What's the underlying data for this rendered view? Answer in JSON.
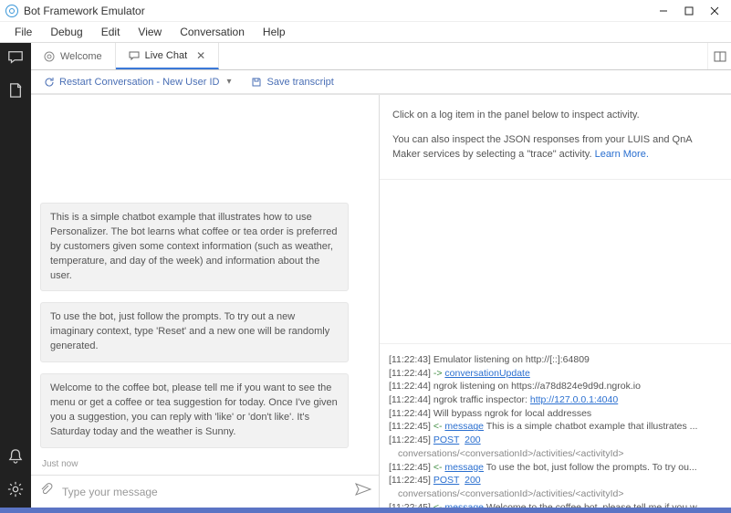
{
  "titlebar": {
    "title": "Bot Framework Emulator"
  },
  "menu": {
    "items": [
      "File",
      "Debug",
      "Edit",
      "View",
      "Conversation",
      "Help"
    ]
  },
  "tabs": {
    "welcome": "Welcome",
    "livechat": "Live Chat"
  },
  "toolbar": {
    "restart": "Restart Conversation - New User ID",
    "save": "Save transcript"
  },
  "chat": {
    "messages": [
      "This is a simple chatbot example that illustrates how to use Personalizer. The bot learns what coffee or tea order is preferred by customers given some context information (such as weather, temperature, and day of the week) and information about the user.",
      "To use the bot, just follow the prompts. To try out a new imaginary context, type 'Reset' and a new one will be randomly generated.",
      "Welcome to the coffee bot, please tell me if you want to see the menu or get a coffee or tea suggestion for today. Once I've given you a suggestion, you can reply with 'like' or 'don't like'. It's Saturday today and the weather is Sunny."
    ],
    "timestamp": "Just now",
    "placeholder": "Type your message"
  },
  "inspector": {
    "line1": "Click on a log item in the panel below to inspect activity.",
    "line2a": "You can also inspect the JSON responses from your LUIS and QnA Maker services by selecting a \"trace\" activity. ",
    "learn_more": "Learn More."
  },
  "log": {
    "l0_ts": "[11:22:43]",
    "l0_txt": " Emulator listening on http://[::]:64809",
    "l1_ts": "[11:22:44]",
    "l1_dir": " -> ",
    "l1_link": "conversationUpdate",
    "l2_ts": "[11:22:44]",
    "l2_txt": " ngrok listening on https://a78d824e9d9d.ngrok.io",
    "l3_ts": "[11:22:44]",
    "l3_txt": " ngrok traffic inspector: ",
    "l3_link": "http://127.0.0.1:4040",
    "l4_ts": "[11:22:44]",
    "l4_txt": " Will bypass ngrok for local addresses",
    "l5_ts": "[11:22:45]",
    "l5_dir": " <- ",
    "l5_link": "message",
    "l5_txt": " This is a simple chatbot example that illustrates ...",
    "l6_ts": "[11:22:45]",
    "l6_post": "POST",
    "l6_code": "200",
    "l6_path": "conversations/<conversationId>/activities/<activityId>",
    "l7_ts": "[11:22:45]",
    "l7_dir": " <- ",
    "l7_link": "message",
    "l7_txt": " To use the bot, just follow the prompts. To try ou...",
    "l8_ts": "[11:22:45]",
    "l8_post": "POST",
    "l8_code": "200",
    "l8_path": "conversations/<conversationId>/activities/<activityId>",
    "l9_ts": "[11:22:45]",
    "l9_dir": " <- ",
    "l9_link": "message",
    "l9_txt": " Welcome to the coffee bot, please tell me if you w..."
  }
}
